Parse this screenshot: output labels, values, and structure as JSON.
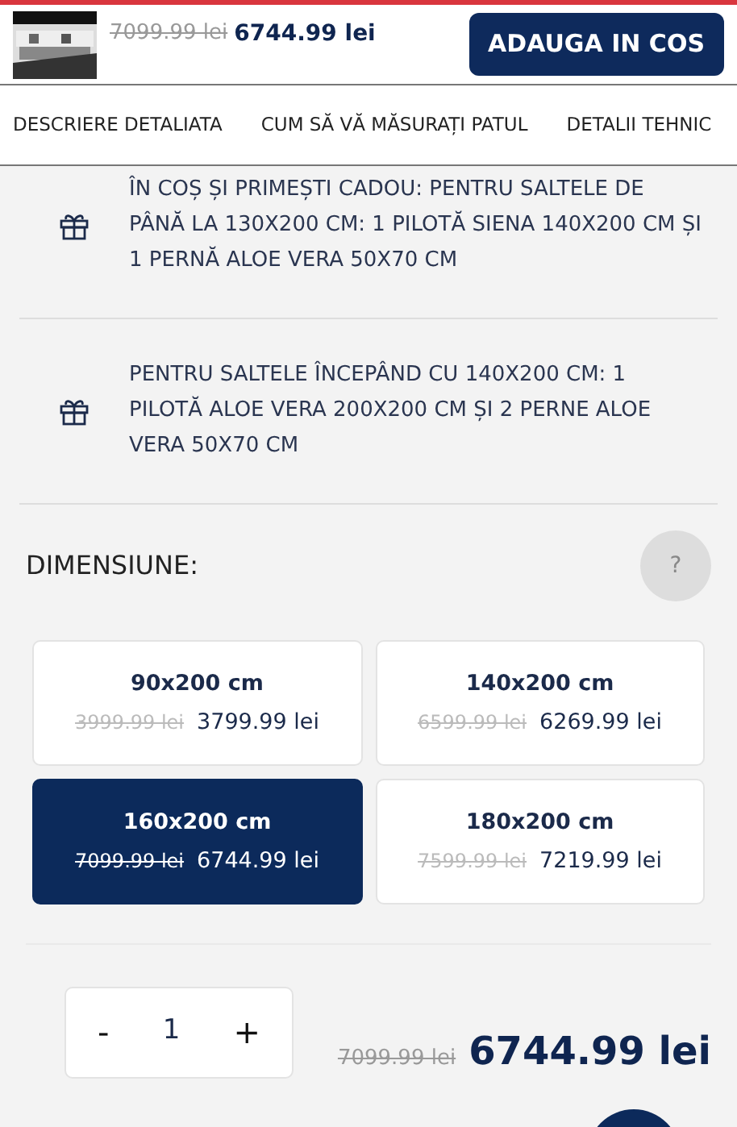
{
  "header": {
    "old_price": "7099.99 lei",
    "price": "6744.99 lei",
    "button": "ADAUGA IN COS"
  },
  "tabs": [
    {
      "label": "DESCRIERE DETALIATA"
    },
    {
      "label": "CUM SĂ VĂ MĂSURAȚI PATUL"
    },
    {
      "label": "DETALII TEHNIC"
    }
  ],
  "gifts": [
    {
      "text": "ÎN COȘ ȘI PRIMEȘTI CADOU: PENTRU SALTELE DE PÂNĂ LA 130X200 CM: 1 PILOTĂ SIENA 140X200 CM ȘI 1 PERNĂ ALOE VERA 50X70 CM"
    },
    {
      "text": "PENTRU SALTELE ÎNCEPÂND CU 140X200 CM: 1 PILOTĂ ALOE VERA 200X200 CM ȘI 2 PERNE ALOE VERA 50X70 CM"
    }
  ],
  "size": {
    "label": "DIMENSIUNE:",
    "help": "?"
  },
  "sizes": [
    {
      "name": "90x200 cm",
      "old_price": "3999.99 lei",
      "price": "3799.99 lei",
      "selected": false
    },
    {
      "name": "140x200 cm",
      "old_price": "6599.99 lei",
      "price": "6269.99 lei",
      "selected": false
    },
    {
      "name": "160x200 cm",
      "old_price": "7099.99 lei",
      "price": "6744.99 lei",
      "selected": true
    },
    {
      "name": "180x200 cm",
      "old_price": "7599.99 lei",
      "price": "7219.99 lei",
      "selected": false
    }
  ],
  "quantity": {
    "minus": "-",
    "value": "1",
    "plus": "+"
  },
  "total": {
    "old_price": "7099.99 lei",
    "price": "6744.99 lei"
  }
}
